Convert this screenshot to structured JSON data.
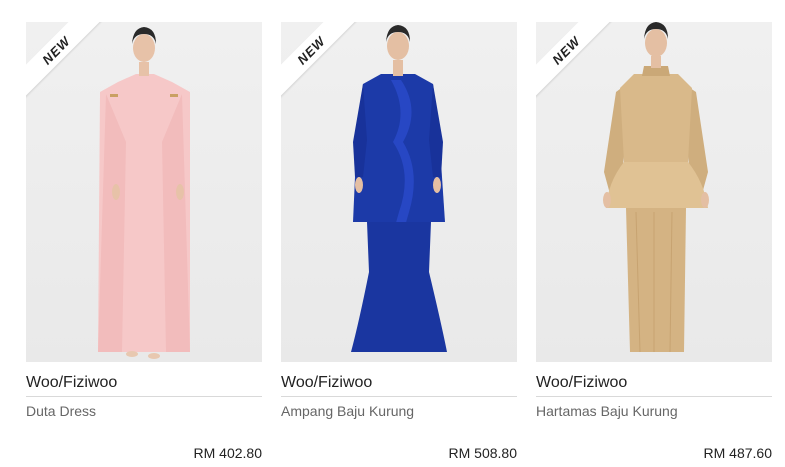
{
  "products": [
    {
      "badge": "NEW",
      "brand": "Woo/Fiziwoo",
      "name": "Duta Dress",
      "price": "RM 402.80",
      "dress_color": "#f6c8c8"
    },
    {
      "badge": "NEW",
      "brand": "Woo/Fiziwoo",
      "name": "Ampang Baju Kurung",
      "price": "RM 508.80",
      "dress_color": "#1c3aa8"
    },
    {
      "badge": "NEW",
      "brand": "Woo/Fiziwoo",
      "name": "Hartamas Baju Kurung",
      "price": "RM 487.60",
      "dress_color": "#d9b98a"
    }
  ],
  "colors": {
    "background": "#ffffff",
    "photo_bg": "#ececec",
    "divider": "#d9d9d9",
    "text": "#222222",
    "subtext": "#666666"
  }
}
